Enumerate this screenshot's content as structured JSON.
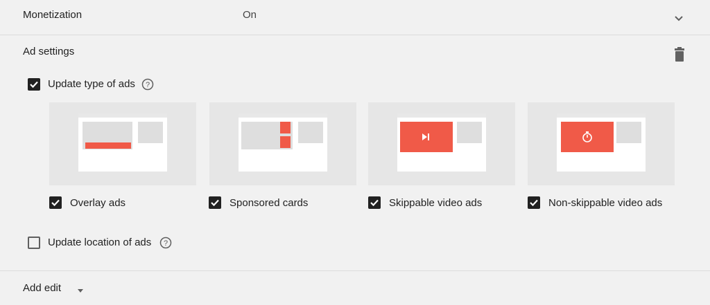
{
  "monetization": {
    "label": "Monetization",
    "value": "On",
    "expand_icon": "chevron-down-icon"
  },
  "ad_settings": {
    "title": "Ad settings",
    "delete_icon": "trash-icon",
    "update_type": {
      "label": "Update type of ads",
      "checked": true,
      "help_icon": "help-circle-icon"
    },
    "ad_types": [
      {
        "label": "Overlay ads",
        "checked": true
      },
      {
        "label": "Sponsored cards",
        "checked": true
      },
      {
        "label": "Skippable video ads",
        "checked": true
      },
      {
        "label": "Non-skippable video ads",
        "checked": true
      }
    ],
    "update_location": {
      "label": "Update location of ads",
      "checked": false,
      "help_icon": "help-circle-icon"
    }
  },
  "footer": {
    "add_edit_label": "Add edit",
    "dropdown_icon": "caret-down-icon"
  },
  "colors": {
    "accent_red": "#f05a48",
    "background": "#f1f1f1",
    "card_bg": "#e6e6e6"
  }
}
